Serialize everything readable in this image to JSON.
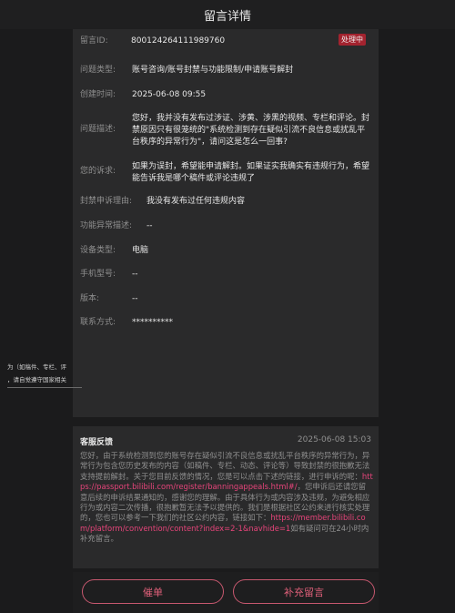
{
  "header": {
    "title": "留言详情"
  },
  "status_badge": "处理中",
  "fields": [
    {
      "label": "留言ID:",
      "value": "800124264111989760"
    },
    {
      "label": "问题类型:",
      "value": "账号咨询/账号封禁与功能限制/申请账号解封"
    },
    {
      "label": "创建时间:",
      "value": "2025-06-08 09:55"
    },
    {
      "label": "问题描述:",
      "value": "您好，我并没有发布过涉证、涉黄、涉黑的视频、专栏和评论。封禁原因只有很笼统的\"系统检测到存在疑似引流不良信息或扰乱平台秩序的异常行为\"，请问这是怎么一回事?"
    },
    {
      "label": "您的诉求:",
      "value": "如果为误封，希望能申请解封。如果证实我确实有违规行为，希望能告诉我是哪个稿件或评论违规了"
    },
    {
      "label": "封禁申诉理由:",
      "value": "我没有发布过任何违规内容"
    },
    {
      "label": "功能异常描述:",
      "value": "--"
    },
    {
      "label": "设备类型:",
      "value": "电脑"
    },
    {
      "label": "手机型号:",
      "value": "--"
    },
    {
      "label": "版本:",
      "value": "--"
    },
    {
      "label": "联系方式:",
      "value": "**********"
    }
  ],
  "attachment_lines": [
    "为（如稿件、专栏、评",
    "，请自觉遵守国家相关"
  ],
  "reply": {
    "title": "客服反馈",
    "date": "2025-06-08 15:03",
    "text1": "您好，由于系统检测到您的账号存在疑似引流不良信息或扰乱平台秩序的异常行为，异常行为包含您历史发布的内容（如稿件、专栏、动态、评论等）导致封禁的很抱歉无法支持提前解封。关于您目前反馈的情况，您是可以点击下述的链接，进行申诉的呢：",
    "link1": "https://passport.bilibili.com/register/banningappeals.html#/",
    "text2": "，您申诉后还请您留意后续的申诉结果通知的，感谢您的理解。由于具体行为或内容涉及违规，为避免相应行为或内容二次传播，很抱歉暂无法予以提供的。我们是根据社区公约来进行核实处理的，您也可以参考一下我们的社区公约内容，链接如下：",
    "link2": "https://member.bilibili.com/platform/convention/content?index=2-1&navhide=1",
    "text3": "如有疑问可在24小时内补充留言。"
  },
  "buttons": {
    "urge": "催单",
    "add": "补充留言"
  },
  "colors": {
    "accent": "#e0607a",
    "badge": "#a3232f",
    "link": "#e6447a"
  }
}
